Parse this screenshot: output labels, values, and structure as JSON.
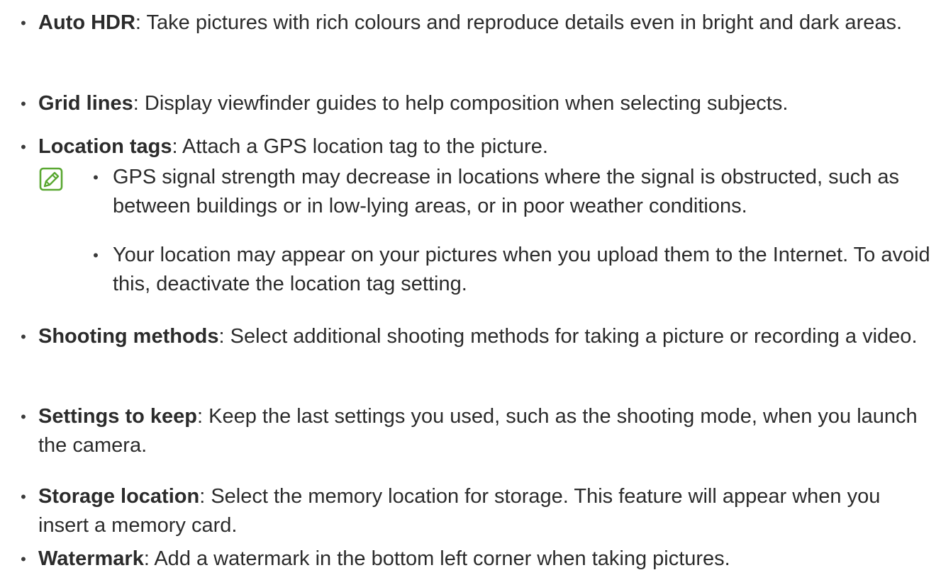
{
  "items": [
    {
      "term": "Auto HDR",
      "desc": ": Take pictures with rich colours and reproduce details even in bright and dark areas."
    },
    {
      "term": "Grid lines",
      "desc": ": Display viewfinder guides to help composition when selecting subjects."
    },
    {
      "term": "Location tags",
      "desc": ": Attach a GPS location tag to the picture."
    },
    {
      "term": "Shooting methods",
      "desc": ": Select additional shooting methods for taking a picture or recording a video."
    },
    {
      "term": "Settings to keep",
      "desc": ": Keep the last settings you used, such as the shooting mode, when you launch the camera."
    },
    {
      "term": "Storage location",
      "desc": ": Select the memory location for storage. This feature will appear when you insert a memory card."
    },
    {
      "term": "Watermark",
      "desc": ": Add a watermark in the bottom left corner when taking pictures."
    }
  ],
  "bullet_glyph": "•",
  "note": {
    "icon": "note-pencil-icon",
    "icon_color": "#5aa832",
    "lines": [
      "GPS signal strength may decrease in locations where the signal is obstructed, such as between buildings or in low-lying areas, or in poor weather conditions.",
      "Your location may appear on your pictures when you upload them to the Internet. To avoid this, deactivate the location tag setting."
    ]
  }
}
